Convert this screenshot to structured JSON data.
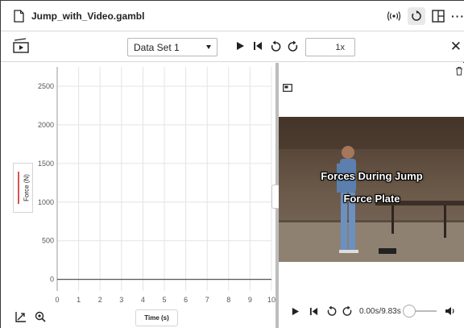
{
  "window": {
    "title": "Jump_with_Video.gambl",
    "icons": [
      "file-icon",
      "broadcast-icon",
      "reload-icon",
      "layout-icon",
      "more-icon"
    ]
  },
  "toolbar": {
    "dataset": "Data Set 1",
    "speed": "1x",
    "icons": [
      "media-player-icon",
      "play-icon",
      "skip-back-icon",
      "rewind-icon",
      "forward-icon",
      "close-icon"
    ]
  },
  "graph": {
    "y_axis_label": "Force (N)",
    "x_axis_label": "Time (s)",
    "y_ticks": [
      "0",
      "500",
      "1000",
      "1500",
      "2000",
      "2500"
    ],
    "x_ticks": [
      "0",
      "1",
      "2",
      "3",
      "4",
      "5",
      "6",
      "7",
      "8",
      "9",
      "10"
    ],
    "series_color": "#d9534f",
    "tools": [
      "autoscale-icon",
      "zoom-icon"
    ]
  },
  "chart_data": {
    "type": "line",
    "title": "",
    "xlabel": "Time (s)",
    "ylabel": "Force (N)",
    "xlim": [
      0,
      10
    ],
    "ylim": [
      -150,
      2750
    ],
    "x_ticks": [
      0,
      1,
      2,
      3,
      4,
      5,
      6,
      7,
      8,
      9,
      10
    ],
    "y_ticks": [
      0,
      500,
      1000,
      1500,
      2000,
      2500
    ],
    "grid": true,
    "series": []
  },
  "video": {
    "title_line1": "Forces During Jump",
    "title_line2": "Force Plate",
    "time": "0.00s/9.83s",
    "progress": 0,
    "icons": [
      "trash-icon",
      "picture-in-picture-icon",
      "play-icon",
      "skip-back-icon",
      "rewind-icon",
      "forward-icon",
      "volume-icon"
    ]
  }
}
